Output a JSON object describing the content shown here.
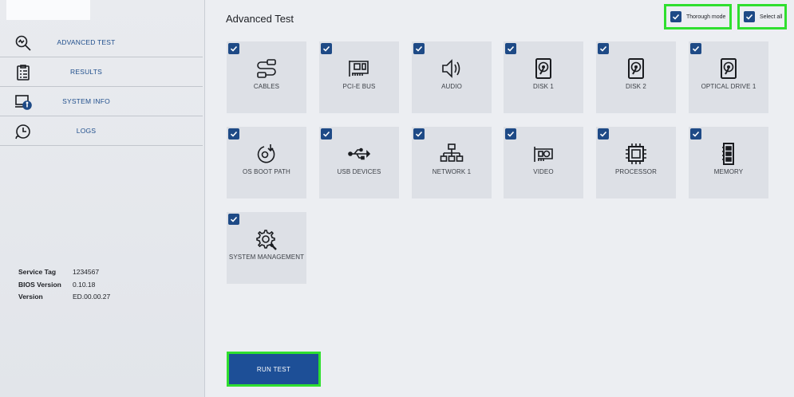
{
  "sidebar": {
    "items": [
      {
        "label": "ADVANCED TEST",
        "icon": "search-icon"
      },
      {
        "label": "RESULTS",
        "icon": "clipboard-icon"
      },
      {
        "label": "SYSTEM INFO",
        "icon": "monitor-info-icon"
      },
      {
        "label": "LOGS",
        "icon": "clock-icon"
      }
    ],
    "info": [
      {
        "key": "Service Tag",
        "value": "1234567"
      },
      {
        "key": "BIOS Version",
        "value": "0.10.18"
      },
      {
        "key": "Version",
        "value": "ED.00.00.27"
      }
    ]
  },
  "main": {
    "title": "Advanced Test",
    "thorough_mode_label": "Thorough mode",
    "thorough_mode_checked": true,
    "select_all_label": "Select all",
    "select_all_checked": true,
    "tiles": [
      {
        "label": "CABLES",
        "icon": "cable-icon",
        "checked": true
      },
      {
        "label": "PCI-E BUS",
        "icon": "pci-card-icon",
        "checked": true
      },
      {
        "label": "AUDIO",
        "icon": "speaker-icon",
        "checked": true
      },
      {
        "label": "DISK 1",
        "icon": "disk-icon",
        "checked": true
      },
      {
        "label": "DISK 2",
        "icon": "disk-icon",
        "checked": true
      },
      {
        "label": "OPTICAL DRIVE 1",
        "icon": "optical-drive-icon",
        "checked": true
      },
      {
        "label": "OS BOOT PATH",
        "icon": "boot-path-icon",
        "checked": true
      },
      {
        "label": "USB DEVICES",
        "icon": "usb-icon",
        "checked": true
      },
      {
        "label": "NETWORK 1",
        "icon": "network-icon",
        "checked": true
      },
      {
        "label": "VIDEO",
        "icon": "video-card-icon",
        "checked": true
      },
      {
        "label": "PROCESSOR",
        "icon": "processor-icon",
        "checked": true
      },
      {
        "label": "MEMORY",
        "icon": "memory-icon",
        "checked": true
      },
      {
        "label": "SYSTEM MANAGEMENT",
        "icon": "gear-wrench-icon",
        "checked": true
      }
    ],
    "run_label": "RUN TEST"
  },
  "colors": {
    "accent": "#1d4f97",
    "checkbox": "#1e4a86",
    "highlight": "#2fdf2f"
  }
}
